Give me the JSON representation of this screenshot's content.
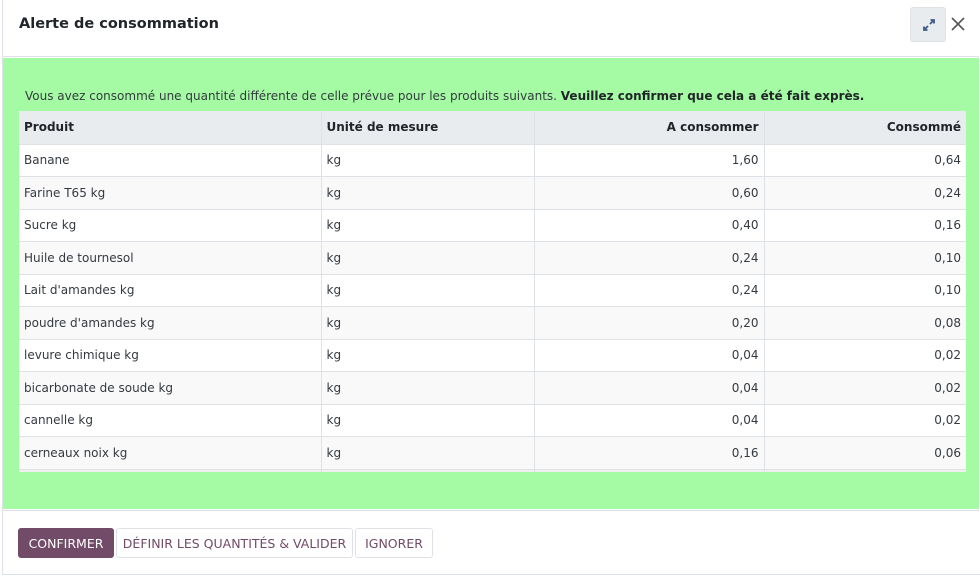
{
  "dialog": {
    "title": "Alerte de consommation",
    "expand_icon": "expand-icon",
    "close_icon": "close-icon"
  },
  "message": {
    "text": "Vous avez consommé une quantité différente de celle prévue pour les produits suivants.",
    "emphasis": "Veuillez confirmer que cela a été fait exprès."
  },
  "table": {
    "headers": {
      "product": "Produit",
      "uom": "Unité de mesure",
      "to_consume": "A consommer",
      "consumed": "Consommé"
    },
    "rows": [
      {
        "product": "Banane",
        "uom": "kg",
        "to_consume": "1,60",
        "consumed": "0,64"
      },
      {
        "product": "Farine T65 kg",
        "uom": "kg",
        "to_consume": "0,60",
        "consumed": "0,24"
      },
      {
        "product": "Sucre kg",
        "uom": "kg",
        "to_consume": "0,40",
        "consumed": "0,16"
      },
      {
        "product": "Huile de tournesol",
        "uom": "kg",
        "to_consume": "0,24",
        "consumed": "0,10"
      },
      {
        "product": "Lait d'amandes kg",
        "uom": "kg",
        "to_consume": "0,24",
        "consumed": "0,10"
      },
      {
        "product": "poudre d'amandes kg",
        "uom": "kg",
        "to_consume": "0,20",
        "consumed": "0,08"
      },
      {
        "product": "levure chimique kg",
        "uom": "kg",
        "to_consume": "0,04",
        "consumed": "0,02"
      },
      {
        "product": "bicarbonate de soude kg",
        "uom": "kg",
        "to_consume": "0,04",
        "consumed": "0,02"
      },
      {
        "product": "cannelle kg",
        "uom": "kg",
        "to_consume": "0,04",
        "consumed": "0,02"
      },
      {
        "product": "cerneaux noix kg",
        "uom": "kg",
        "to_consume": "0,16",
        "consumed": "0,06"
      }
    ]
  },
  "footer": {
    "confirm": "Confirmer",
    "set_quantities": "Définir les quantités & valider",
    "ignore": "Ignorer"
  },
  "colors": {
    "highlight_bg": "#a5fba4",
    "primary": "#714b67"
  }
}
